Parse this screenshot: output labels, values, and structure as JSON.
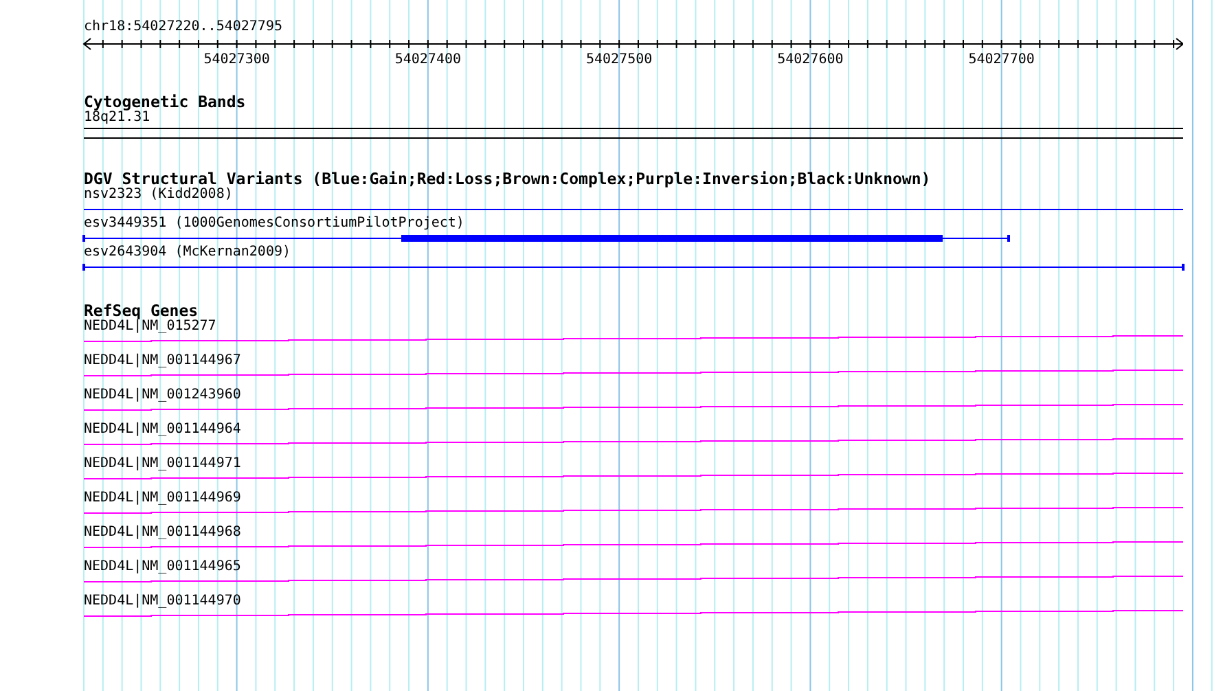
{
  "ruler": {
    "location": "chr18:54027220..54027795",
    "ticks": [
      "54027300",
      "54027400",
      "54027500",
      "54027600",
      "54027700"
    ]
  },
  "tracks": [
    {
      "kind": "cytoband",
      "title": "Cytogenetic Bands",
      "features": [
        {
          "label": "18q21.31"
        }
      ]
    },
    {
      "kind": "variant",
      "title": "DGV Structural Variants (Blue:Gain;Red:Loss;Brown:Complex;Purple:Inversion;Black:Unknown)",
      "features": [
        {
          "label": "nsv2323 (Kidd2008)",
          "color": "#0000ff"
        },
        {
          "label": "esv3449351 (1000GenomesConsortiumPilotProject)",
          "color": "#0000ff"
        },
        {
          "label": "esv2643904 (McKernan2009)",
          "color": "#0000ff"
        }
      ]
    },
    {
      "kind": "gene",
      "title": "RefSeq Genes",
      "features": [
        {
          "label": "NEDD4L|NM_015277"
        },
        {
          "label": "NEDD4L|NM_001144967"
        },
        {
          "label": "NEDD4L|NM_001243960"
        },
        {
          "label": "NEDD4L|NM_001144964"
        },
        {
          "label": "NEDD4L|NM_001144971"
        },
        {
          "label": "NEDD4L|NM_001144969"
        },
        {
          "label": "NEDD4L|NM_001144968"
        },
        {
          "label": "NEDD4L|NM_001144965"
        },
        {
          "label": "NEDD4L|NM_001144970"
        }
      ]
    }
  ]
}
